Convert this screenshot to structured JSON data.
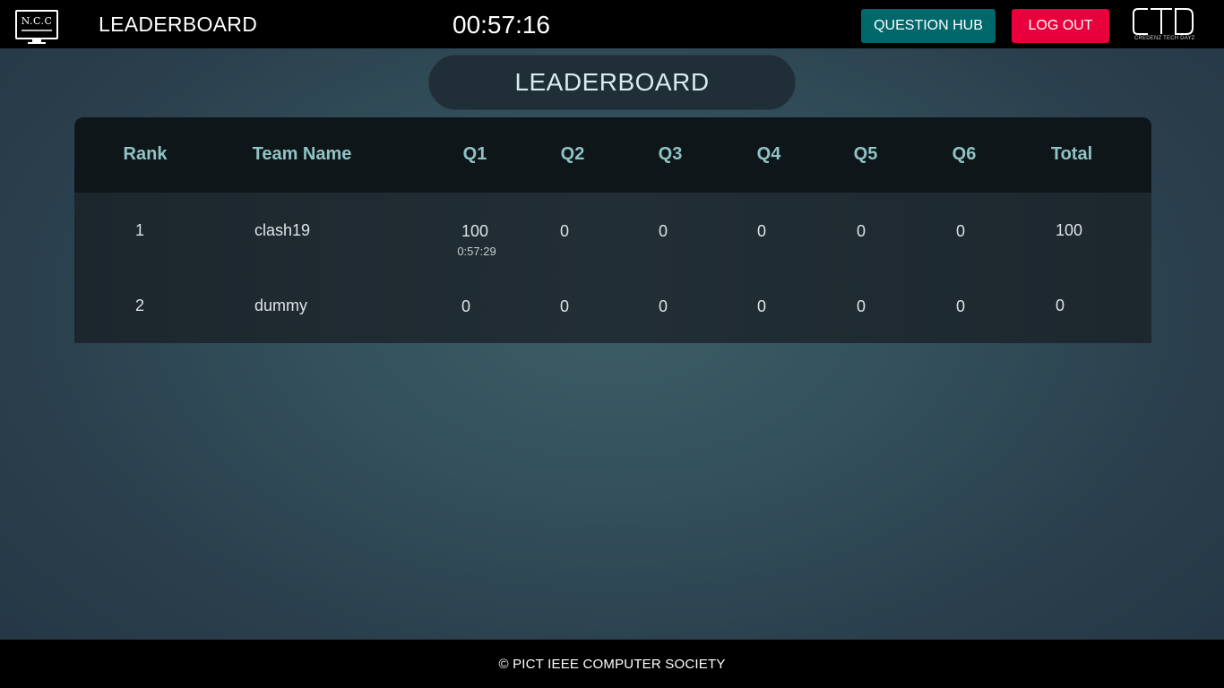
{
  "header": {
    "logo_text": "N.C.C",
    "title": "LEADERBOARD",
    "timer": "00:57:16",
    "question_hub_label": "QUESTION HUB",
    "logout_label": "LOG OUT",
    "partner_logo_text": "CREDENZ TECH DAYZ"
  },
  "heading": "LEADERBOARD",
  "table": {
    "columns": [
      "Rank",
      "Team Name",
      "Q1",
      "Q2",
      "Q3",
      "Q4",
      "Q5",
      "Q6",
      "Total"
    ],
    "rows": [
      {
        "rank": "1",
        "team": "clash19",
        "scores": [
          "100",
          "0",
          "0",
          "0",
          "0",
          "0"
        ],
        "q1_time": "0:57:29",
        "total": "100"
      },
      {
        "rank": "2",
        "team": "dummy",
        "scores": [
          "0",
          "0",
          "0",
          "0",
          "0",
          "0"
        ],
        "total": "0"
      }
    ]
  },
  "footer": "© PICT IEEE COMPUTER SOCIETY"
}
